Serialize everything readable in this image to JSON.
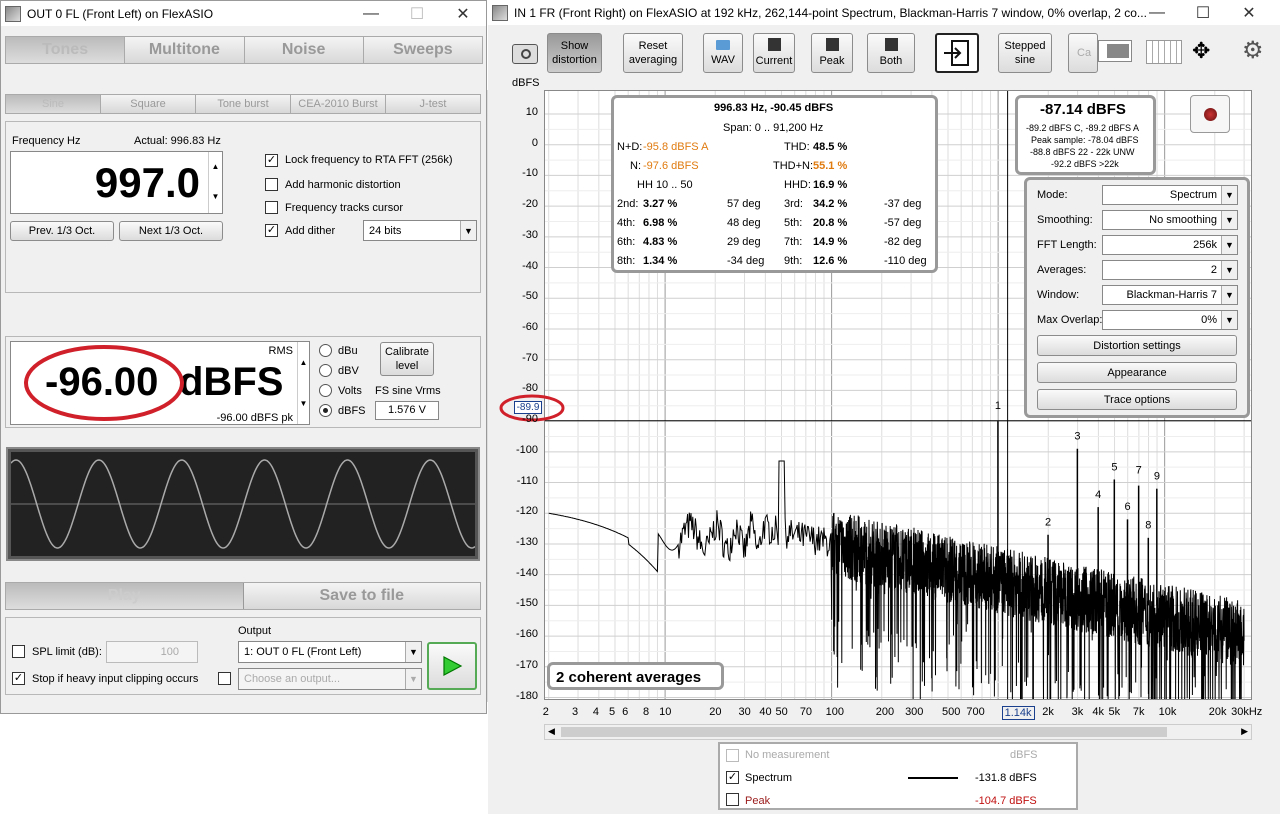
{
  "left": {
    "title": "OUT 0 FL (Front Left) on FlexASIO",
    "tabs": [
      "Tones",
      "Multitone",
      "Noise",
      "Sweeps"
    ],
    "subtabs": [
      "Sine",
      "Square",
      "Tone burst",
      "CEA-2010 Burst",
      "J-test"
    ],
    "freq_label": "Frequency Hz",
    "actual": "Actual: 996.83 Hz",
    "freq_value": "997.0",
    "prev": "Prev. 1/3 Oct.",
    "next": "Next 1/3 Oct.",
    "lock": "Lock frequency to RTA FFT (256k)",
    "harm": "Add harmonic distortion",
    "track": "Frequency tracks cursor",
    "dither": "Add dither",
    "bits": "24 bits",
    "rms": "RMS",
    "level": "-96.00",
    "level_unit": "dBFS",
    "pk": "-96.00 dBFS pk",
    "units": [
      "dBu",
      "dBV",
      "Volts",
      "dBFS"
    ],
    "calibrate": "Calibrate level",
    "fs_sine": "FS sine Vrms",
    "fs_value": "1.576 V",
    "play": "Play",
    "save": "Save to file",
    "spl": "SPL limit (dB):",
    "spl_val": "100",
    "clip": "Stop if heavy input clipping occurs",
    "output_label": "Output",
    "output": "1: OUT 0 FL (Front Left)",
    "choose": "Choose an output..."
  },
  "right": {
    "title": "IN 1 FR (Front Right) on FlexASIO at 192 kHz, 262,144-point Spectrum, Blackman-Harris 7 window, 0% overlap, 2 co...",
    "toolbar": {
      "show": "Show distortion",
      "reset": "Reset averaging",
      "wav": "WAV",
      "current": "Current",
      "peak": "Peak",
      "both": "Both",
      "stepped": "Stepped sine",
      "ca": "Ca"
    },
    "dbfs": "dBFS",
    "yticks": [
      "10",
      "0",
      "-10",
      "-20",
      "-30",
      "-40",
      "-50",
      "-60",
      "-70",
      "-80",
      "-90",
      "-100",
      "-110",
      "-120",
      "-130",
      "-140",
      "-150",
      "-160",
      "-170",
      "-180"
    ],
    "xticks": [
      "2",
      "3",
      "4",
      "5",
      "6",
      "8",
      "10",
      "20",
      "30",
      "40",
      "50",
      "70",
      "100",
      "200",
      "300",
      "500",
      "700",
      "1.14k",
      "2k",
      "3k",
      "4k",
      "5k",
      "7k",
      "10k",
      "20k",
      "30kHz"
    ],
    "cursor_y": "-89.9",
    "dist": {
      "head": "996.83 Hz, -90.45 dBFS",
      "span": "Span: 0 .. 91,200 Hz",
      "nd_l": "N+D:",
      "nd_v": "-95.8 dBFS A",
      "thd_l": "THD:",
      "thd_v": "48.5 %",
      "n_l": "N:",
      "n_v": "-97.6 dBFS",
      "thdn_l": "THD+N:",
      "thdn_v": "55.1 %",
      "hh": "HH 10 .. 50",
      "hhd_l": "HHD:",
      "hhd_v": "16.9 %",
      "rows": [
        [
          "2nd:",
          "3.27 %",
          "57 deg",
          "3rd:",
          "34.2 %",
          "-37 deg"
        ],
        [
          "4th:",
          "6.98 %",
          "48 deg",
          "5th:",
          "20.8 %",
          "-57 deg"
        ],
        [
          "6th:",
          "4.83 %",
          "29 deg",
          "7th:",
          "14.9 %",
          "-82 deg"
        ],
        [
          "8th:",
          "1.34 %",
          "-34 deg",
          "9th:",
          "12.6 %",
          "-110 deg"
        ]
      ]
    },
    "meter": {
      "big": "-87.14 dBFS",
      "l1": "-89.2 dBFS C, -89.2 dBFS A",
      "l2": "Peak sample: -78.04 dBFS",
      "l3": "-88.8 dBFS 22 - 22k UNW",
      "l4": "-92.2 dBFS >22k"
    },
    "settings": [
      [
        "Mode:",
        "Spectrum"
      ],
      [
        "Smoothing:",
        "No  smoothing"
      ],
      [
        "FFT Length:",
        "256k"
      ],
      [
        "Averages:",
        "2"
      ],
      [
        "Window:",
        "Blackman-Harris 7"
      ],
      [
        "Max Overlap:",
        "0%"
      ]
    ],
    "dist_settings": "Distortion settings",
    "appearance": "Appearance",
    "trace": "Trace options",
    "averages_note": "2 coherent averages",
    "harm_labels": [
      "1",
      "2",
      "3",
      "4",
      "5",
      "6",
      "7",
      "8",
      "9"
    ],
    "legend": {
      "hdr_name": "No measurement",
      "hdr_unit": "dBFS",
      "spectrum": "Spectrum",
      "spectrum_v": "-131.8 dBFS",
      "peak": "Peak",
      "peak_v": "-104.7 dBFS"
    }
  }
}
